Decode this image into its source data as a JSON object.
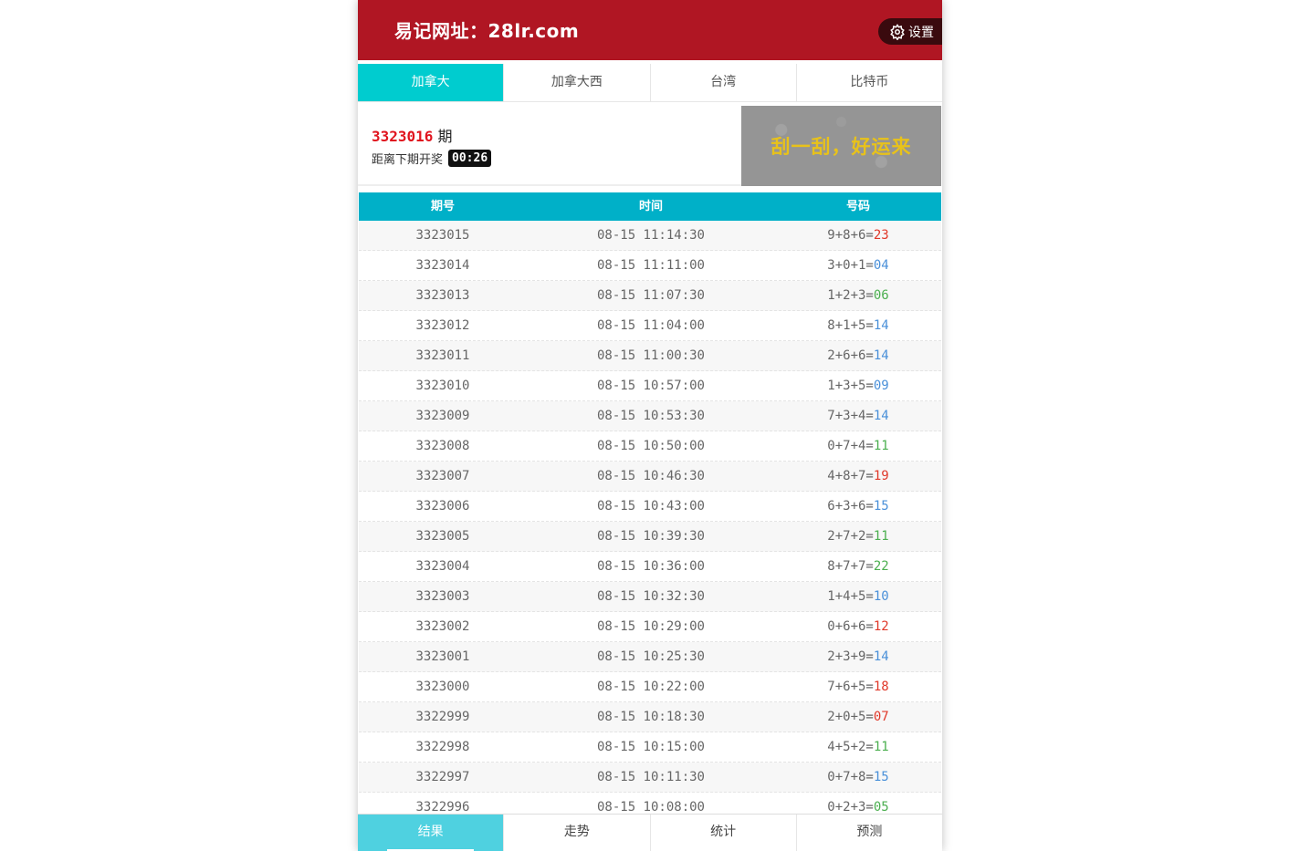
{
  "header": {
    "title": "易记网址：28lr.com",
    "settings_label": "设置"
  },
  "tabs": [
    {
      "label": "加拿大",
      "active": true
    },
    {
      "label": "加拿大西",
      "active": false
    },
    {
      "label": "台湾",
      "active": false
    },
    {
      "label": "比特币",
      "active": false
    }
  ],
  "draw": {
    "issue": "3323016",
    "issue_suffix": " 期",
    "countdown_label": "距离下期开奖",
    "countdown": "00:26"
  },
  "scratch": {
    "label": "刮一刮，好运来"
  },
  "table": {
    "headers": [
      "期号",
      "时间",
      "号码"
    ],
    "rows": [
      {
        "issue": "3323015",
        "time": "08-15 11:14:30",
        "expr": "9+8+6=",
        "sum": "23",
        "color": "red"
      },
      {
        "issue": "3323014",
        "time": "08-15 11:11:00",
        "expr": "3+0+1=",
        "sum": "04",
        "color": "blue"
      },
      {
        "issue": "3323013",
        "time": "08-15 11:07:30",
        "expr": "1+2+3=",
        "sum": "06",
        "color": "green"
      },
      {
        "issue": "3323012",
        "time": "08-15 11:04:00",
        "expr": "8+1+5=",
        "sum": "14",
        "color": "blue"
      },
      {
        "issue": "3323011",
        "time": "08-15 11:00:30",
        "expr": "2+6+6=",
        "sum": "14",
        "color": "blue"
      },
      {
        "issue": "3323010",
        "time": "08-15 10:57:00",
        "expr": "1+3+5=",
        "sum": "09",
        "color": "blue"
      },
      {
        "issue": "3323009",
        "time": "08-15 10:53:30",
        "expr": "7+3+4=",
        "sum": "14",
        "color": "blue"
      },
      {
        "issue": "3323008",
        "time": "08-15 10:50:00",
        "expr": "0+7+4=",
        "sum": "11",
        "color": "green"
      },
      {
        "issue": "3323007",
        "time": "08-15 10:46:30",
        "expr": "4+8+7=",
        "sum": "19",
        "color": "red"
      },
      {
        "issue": "3323006",
        "time": "08-15 10:43:00",
        "expr": "6+3+6=",
        "sum": "15",
        "color": "blue"
      },
      {
        "issue": "3323005",
        "time": "08-15 10:39:30",
        "expr": "2+7+2=",
        "sum": "11",
        "color": "green"
      },
      {
        "issue": "3323004",
        "time": "08-15 10:36:00",
        "expr": "8+7+7=",
        "sum": "22",
        "color": "green"
      },
      {
        "issue": "3323003",
        "time": "08-15 10:32:30",
        "expr": "1+4+5=",
        "sum": "10",
        "color": "blue"
      },
      {
        "issue": "3323002",
        "time": "08-15 10:29:00",
        "expr": "0+6+6=",
        "sum": "12",
        "color": "red"
      },
      {
        "issue": "3323001",
        "time": "08-15 10:25:30",
        "expr": "2+3+9=",
        "sum": "14",
        "color": "blue"
      },
      {
        "issue": "3323000",
        "time": "08-15 10:22:00",
        "expr": "7+6+5=",
        "sum": "18",
        "color": "red"
      },
      {
        "issue": "3322999",
        "time": "08-15 10:18:30",
        "expr": "2+0+5=",
        "sum": "07",
        "color": "red"
      },
      {
        "issue": "3322998",
        "time": "08-15 10:15:00",
        "expr": "4+5+2=",
        "sum": "11",
        "color": "green"
      },
      {
        "issue": "3322997",
        "time": "08-15 10:11:30",
        "expr": "0+7+8=",
        "sum": "15",
        "color": "blue"
      },
      {
        "issue": "3322996",
        "time": "08-15 10:08:00",
        "expr": "0+2+3=",
        "sum": "05",
        "color": "green"
      }
    ]
  },
  "bottom_nav": [
    {
      "label": "结果",
      "active": true
    },
    {
      "label": "走势",
      "active": false
    },
    {
      "label": "统计",
      "active": false
    },
    {
      "label": "预测",
      "active": false
    }
  ],
  "colors": {
    "header_bg": "#b01623",
    "tab_active": "#00cccf",
    "table_head": "#00b0c8",
    "sum_red": "#e0392a",
    "sum_blue": "#4a90d9",
    "sum_green": "#4caf50"
  }
}
